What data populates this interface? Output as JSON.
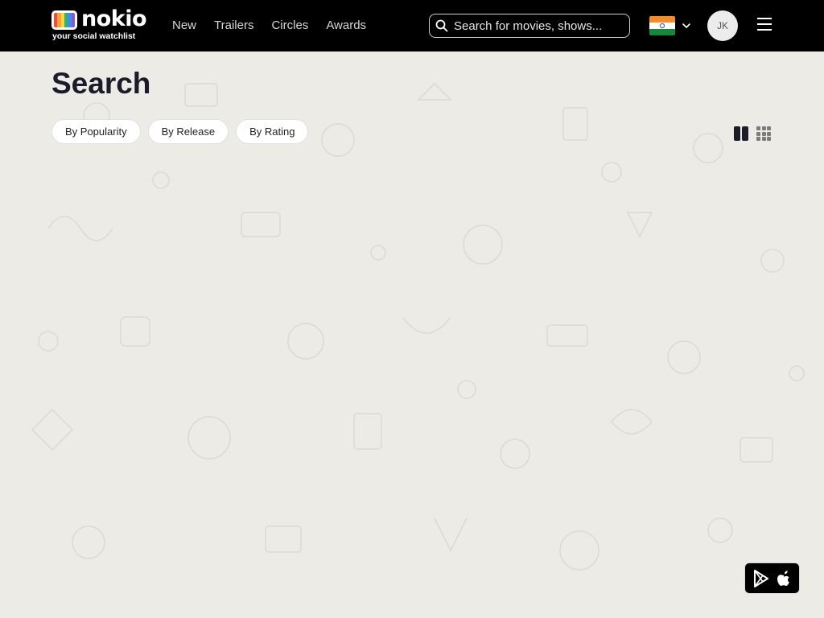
{
  "brand": {
    "name": "nokio",
    "tagline": "your social watchlist",
    "stripe_colors": [
      "#f04a46",
      "#f7a534",
      "#ffd93b",
      "#35b36a",
      "#3c8ee8",
      "#8a55d6"
    ]
  },
  "nav": {
    "items": [
      {
        "label": "New"
      },
      {
        "label": "Trailers"
      },
      {
        "label": "Circles"
      },
      {
        "label": "Awards"
      }
    ]
  },
  "search": {
    "placeholder": "Search for movies, shows...",
    "icon": "search-icon"
  },
  "region": {
    "flag": "india-flag-icon"
  },
  "user": {
    "initials": "JK"
  },
  "page": {
    "title": "Search"
  },
  "sort_options": [
    {
      "label": "By Popularity"
    },
    {
      "label": "By Release"
    },
    {
      "label": "By Rating"
    }
  ],
  "view_modes": [
    "two-column-view-icon",
    "grid-view-icon"
  ],
  "app_badge": {
    "icons": [
      "google-play-icon",
      "apple-icon"
    ]
  },
  "colors": {
    "header_bg": "#000000",
    "page_bg": "#ecebe6",
    "title_text": "#1b1b2a"
  }
}
